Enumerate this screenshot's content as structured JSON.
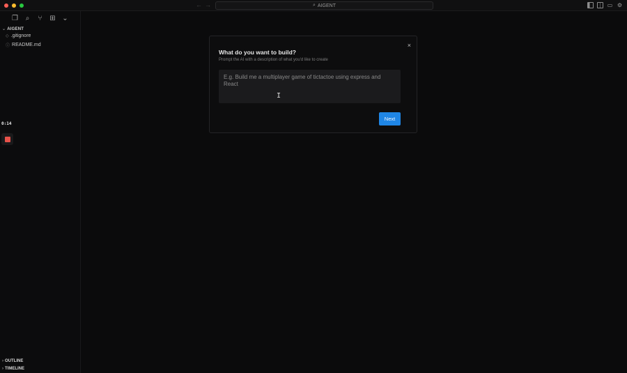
{
  "titlebar": {
    "title": "AIGENT",
    "search_icon": "search-icon",
    "back_icon": "arrow-left-icon",
    "forward_icon": "arrow-right-icon",
    "right_icons": [
      "sidebar-left-icon",
      "split-editor-icon",
      "chat-icon",
      "settings-gear-icon"
    ]
  },
  "activity_bar": {
    "icons": [
      "files-icon",
      "search-icon",
      "source-control-icon",
      "extensions-icon",
      "chevron-down-icon"
    ]
  },
  "explorer": {
    "section_title": "AIGENT",
    "files": [
      {
        "name": ".gitignore",
        "icon": "gitignore-icon"
      },
      {
        "name": "README.md",
        "icon": "info-icon"
      }
    ]
  },
  "recorder": {
    "time": "0:14",
    "stop_icon": "stop-icon",
    "stop_color": "#e8524a"
  },
  "panels": {
    "outline": "OUTLINE",
    "timeline": "TIMELINE"
  },
  "modal": {
    "title": "What do you want to build?",
    "subtitle": "Prompt the AI with a description of what you'd like to create",
    "prompt_placeholder": "E.g. Build me a multiplayer game of tictactoe using express and React",
    "prompt_value": "",
    "next_label": "Next",
    "close_icon": "close-icon",
    "accent_color": "#1f86e6"
  }
}
